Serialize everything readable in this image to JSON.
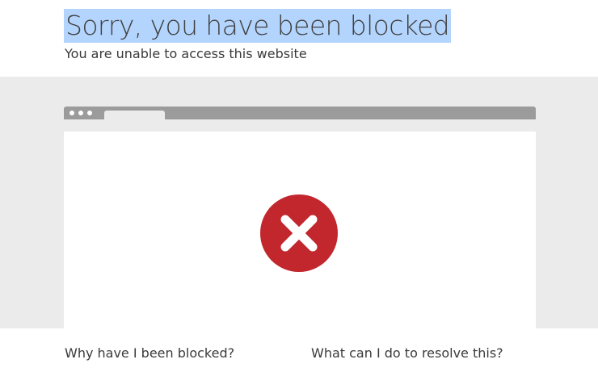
{
  "header": {
    "title": "Sorry, you have been blocked",
    "subtitle": "You are unable to access this website"
  },
  "illustration": {
    "icon": "error-x-circle-icon",
    "icon_color": "#c1272d"
  },
  "footer": {
    "question_why": "Why have I been blocked?",
    "question_resolve": "What can I do to resolve this?"
  },
  "colors": {
    "title_highlight": "#b3d4fc",
    "band": "#ebebeb",
    "browser_bar": "#9b9b9b"
  }
}
